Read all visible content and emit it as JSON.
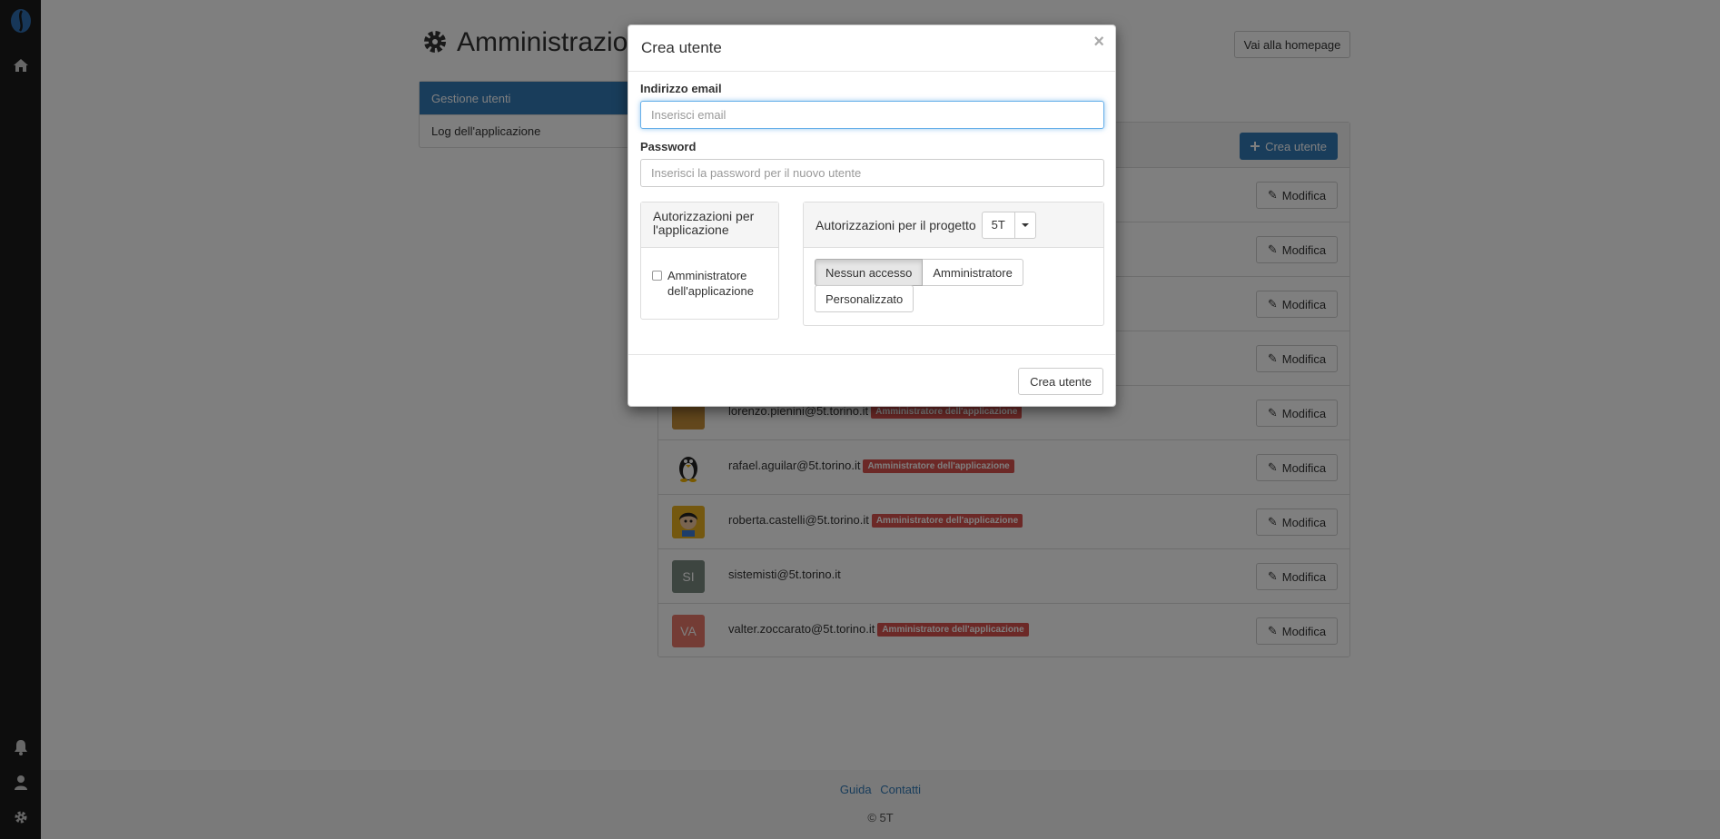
{
  "title": "Amministrazione",
  "header": {
    "home_button": "Vai alla homepage"
  },
  "sidebar": {
    "items": [
      {
        "label": "Gestione utenti"
      },
      {
        "label": "Log dell'applicazione"
      }
    ]
  },
  "users_panel": {
    "create_button": "Crea utente",
    "edit_label": "Modifica",
    "admin_badge": "Amministratore dell'applicazione",
    "rows": [
      {
        "email": "",
        "avatar": ""
      },
      {
        "email": "",
        "avatar": ""
      },
      {
        "email": "",
        "avatar": ""
      },
      {
        "email": "",
        "avatar": ""
      },
      {
        "email": "lorenzo.pienini@5t.torino.it",
        "avatar": ""
      },
      {
        "email": "rafael.aguilar@5t.torino.it",
        "avatar": ""
      },
      {
        "email": "roberta.castelli@5t.torino.it",
        "avatar": ""
      },
      {
        "email": "sistemisti@5t.torino.it",
        "avatar": "SI"
      },
      {
        "email": "valter.zoccarato@5t.torino.it",
        "avatar": "VA"
      }
    ]
  },
  "footer": {
    "links": [
      "Guida",
      "Contatti"
    ],
    "copyright": "© 5T"
  },
  "modal": {
    "title": "Crea utente",
    "close": "×",
    "email_label": "Indirizzo email",
    "email_placeholder": "Inserisci email",
    "password_label": "Password",
    "password_placeholder": "Inserisci la password per il nuovo utente",
    "app_permissions": {
      "heading": "Autorizzazioni per l'applicazione",
      "checkbox_label": "Amministratore dell'applicazione"
    },
    "project_permissions": {
      "heading": "Autorizzazioni per il progetto",
      "project": "5T",
      "options": [
        "Nessun accesso",
        "Amministratore",
        "Personalizzato"
      ],
      "selected": "Nessun accesso"
    },
    "submit": "Crea utente"
  },
  "colors": {
    "primary": "#337ab7",
    "danger": "#d9534f",
    "rail": "#1a1a1a"
  }
}
